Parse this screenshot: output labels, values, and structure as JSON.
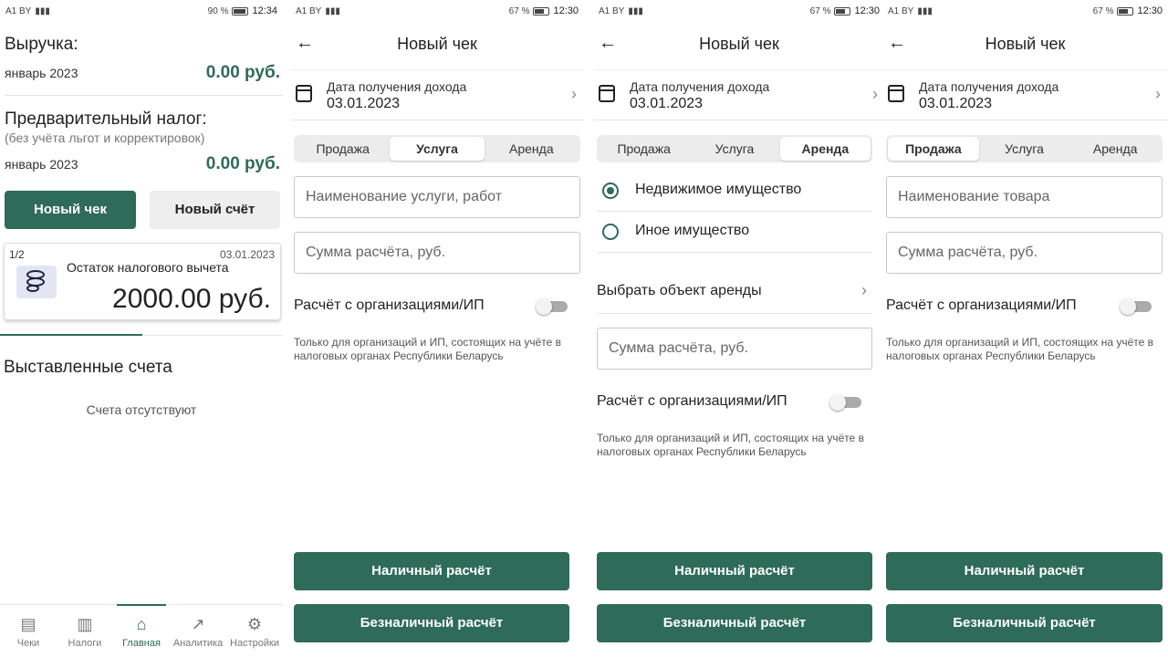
{
  "screen1": {
    "status": {
      "left": "A1 BY",
      "battery": "90 %",
      "time": "12:34"
    },
    "revenue_title": "Выручка:",
    "revenue_period": "январь 2023",
    "revenue_amount": "0.00 руб.",
    "prepay_title": "Предварительный налог:",
    "prepay_note": "(без учёта льгот и корректировок)",
    "prepay_period": "январь 2023",
    "prepay_amount": "0.00 руб.",
    "new_receipt_button": "Новый чек",
    "new_invoice_button": "Новый счёт",
    "card": {
      "page": "1/2",
      "date": "03.01.2023",
      "title": "Остаток налогового вычета",
      "amount": "2000.00 руб."
    },
    "invoices_title": "Выставленные счета",
    "invoices_empty": "Счета отсутствуют",
    "nav": [
      {
        "label": "Чеки",
        "icon": "document-icon"
      },
      {
        "label": "Налоги",
        "icon": "book-icon"
      },
      {
        "label": "Главная",
        "icon": "home-icon"
      },
      {
        "label": "Аналитика",
        "icon": "trend-icon"
      },
      {
        "label": "Настройки",
        "icon": "gear-icon"
      }
    ]
  },
  "screen2": {
    "status": {
      "left": "A1 BY",
      "battery": "67 %",
      "time": "12:30"
    },
    "title": "Новый чек",
    "date_label": "Дата получения дохода",
    "date_value": "03.01.2023",
    "tabs": [
      "Продажа",
      "Услуга",
      "Аренда"
    ],
    "selected_tab": "Услуга",
    "name_placeholder": "Наименование услуги, работ",
    "sum_placeholder": "Сумма расчёта, руб.",
    "org_toggle_label": "Расчёт с организациями/ИП",
    "org_note": "Только для организаций и ИП, состоящих на учёте в налоговых органах Республики Беларусь",
    "cash_button": "Наличный расчёт",
    "cashless_button": "Безналичный расчёт"
  },
  "screen3": {
    "status": {
      "left": "A1 BY",
      "battery": "67 %",
      "time": "12:30"
    },
    "title": "Новый чек",
    "date_label": "Дата получения дохода",
    "date_value": "03.01.2023",
    "tabs": [
      "Продажа",
      "Услуга",
      "Аренда"
    ],
    "selected_tab": "Аренда",
    "radio_options": [
      "Недвижимое имущество",
      "Иное имущество"
    ],
    "selected_radio": "Недвижимое имущество",
    "pick_object": "Выбрать объект аренды",
    "sum_placeholder": "Сумма расчёта, руб.",
    "org_toggle_label": "Расчёт с организациями/ИП",
    "org_note": "Только для организаций и ИП, состоящих на учёте в налоговых органах Республики Беларусь",
    "cash_button": "Наличный расчёт",
    "cashless_button": "Безналичный расчёт"
  },
  "screen4": {
    "status": {
      "left": "A1 BY",
      "battery": "67 %",
      "time": "12:30"
    },
    "title": "Новый чек",
    "date_label": "Дата получения дохода",
    "date_value": "03.01.2023",
    "tabs": [
      "Продажа",
      "Услуга",
      "Аренда"
    ],
    "selected_tab": "Продажа",
    "name_placeholder": "Наименование товара",
    "sum_placeholder": "Сумма расчёта, руб.",
    "org_toggle_label": "Расчёт с организациями/ИП",
    "org_note": "Только для организаций и ИП, состоящих на учёте в налоговых органах Республики Беларусь",
    "cash_button": "Наличный расчёт",
    "cashless_button": "Безналичный расчёт"
  },
  "colors": {
    "accent": "#2e6b58",
    "secondary_button": "#eeeeee",
    "segment_bg": "#ececec"
  }
}
